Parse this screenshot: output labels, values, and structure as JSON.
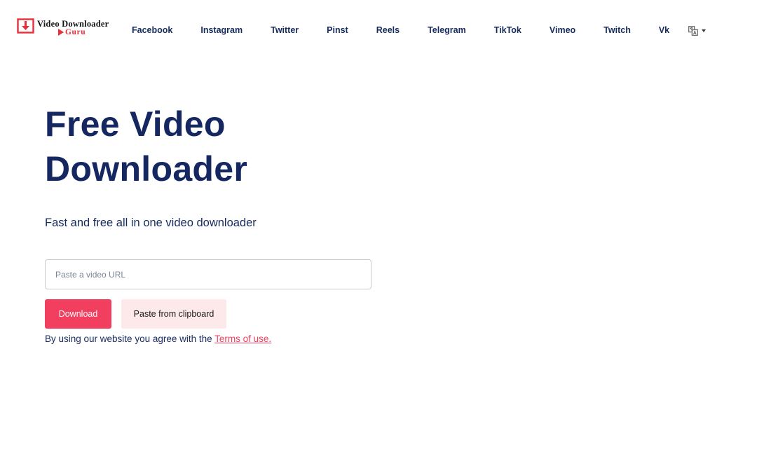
{
  "brand": {
    "name_line1": "Video Downloader",
    "name_line2": "Guru",
    "colors": {
      "accent": "#e8303d",
      "text_dark": "#141414"
    }
  },
  "nav": {
    "links": [
      "Facebook",
      "Instagram",
      "Twitter",
      "Pinst",
      "Reels",
      "Telegram",
      "TikTok",
      "Vimeo",
      "Twitch",
      "Vk"
    ],
    "language_icon": "translate-icon"
  },
  "hero": {
    "title_line1": "Free Video",
    "title_line2": "Downloader",
    "subtitle": "Fast and free all in one video downloader"
  },
  "form": {
    "url_placeholder": "Paste a video URL",
    "url_value": "",
    "download_label": "Download",
    "paste_label": "Paste from clipboard"
  },
  "terms": {
    "prefix": "By using our website you agree with the ",
    "link_text": "Terms of use."
  },
  "colors": {
    "primary_button": "#f23f5f",
    "secondary_button": "#fde8ea",
    "heading": "#142760",
    "body_text": "#152a5e"
  }
}
